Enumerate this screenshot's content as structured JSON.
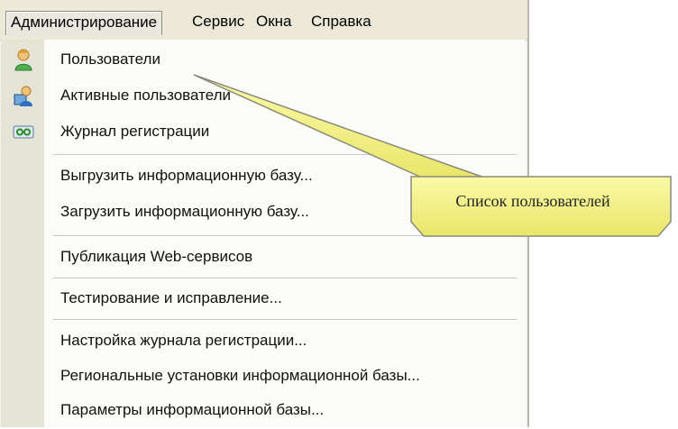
{
  "menubar": {
    "items": [
      {
        "label": "Администрирование",
        "active": true
      },
      {
        "label": "Сервис",
        "active": false
      },
      {
        "label": "Окна",
        "active": false
      },
      {
        "label": "Справка",
        "active": false
      }
    ]
  },
  "menu": {
    "items": [
      {
        "label": "Пользователи",
        "icon": "users-icon"
      },
      {
        "label": "Активные пользователи",
        "icon": "active-users-icon"
      },
      {
        "label": "Журнал регистрации",
        "icon": "registration-log-icon"
      },
      {
        "label": "Выгрузить информационную базу..."
      },
      {
        "label": "Загрузить информационную базу..."
      },
      {
        "label": "Публикация Web-сервисов"
      },
      {
        "label": "Тестирование и исправление..."
      },
      {
        "label": "Настройка журнала регистрации..."
      },
      {
        "label": "Региональные установки информационной базы..."
      },
      {
        "label": "Параметры информационной базы..."
      }
    ]
  },
  "callout": {
    "text": "Список пользователей",
    "color": "#f2f08a",
    "border_color": "#8a8a7a"
  }
}
